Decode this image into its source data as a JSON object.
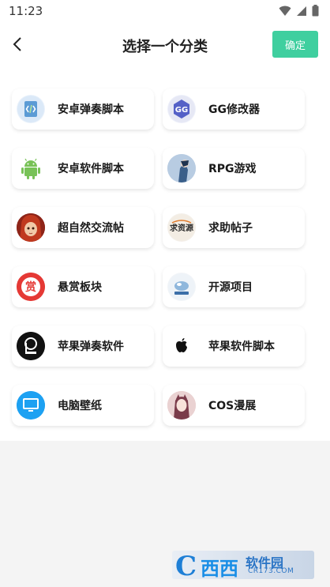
{
  "status_bar": {
    "time": "11:23"
  },
  "header": {
    "title": "选择一个分类",
    "confirm_label": "确定"
  },
  "categories": [
    {
      "label": "安卓弹奏脚本",
      "icon": "code-file-icon"
    },
    {
      "label": "GG修改器",
      "icon": "gg-modifier-icon"
    },
    {
      "label": "安卓软件脚本",
      "icon": "android-icon"
    },
    {
      "label": "RPG游戏",
      "icon": "rpg-avatar-icon"
    },
    {
      "label": "超自然交流帖",
      "icon": "supernatural-avatar-icon"
    },
    {
      "label": "求助帖子",
      "icon": "help-post-icon",
      "icon_text": "求资源"
    },
    {
      "label": "悬赏板块",
      "icon": "reward-icon",
      "icon_text": "赏"
    },
    {
      "label": "开源项目",
      "icon": "open-source-icon"
    },
    {
      "label": "苹果弹奏软件",
      "icon": "piano-logo-icon"
    },
    {
      "label": "苹果软件脚本",
      "icon": "apple-icon"
    },
    {
      "label": "电脑壁纸",
      "icon": "monitor-icon"
    },
    {
      "label": "COS漫展",
      "icon": "cos-avatar-icon"
    }
  ],
  "watermark": {
    "brand": "西西",
    "name": "软件园",
    "url": "CR173.COM"
  },
  "colors": {
    "accent": "#3fcf9f",
    "reward_red": "#e53935",
    "monitor_blue": "#1da1f2"
  }
}
